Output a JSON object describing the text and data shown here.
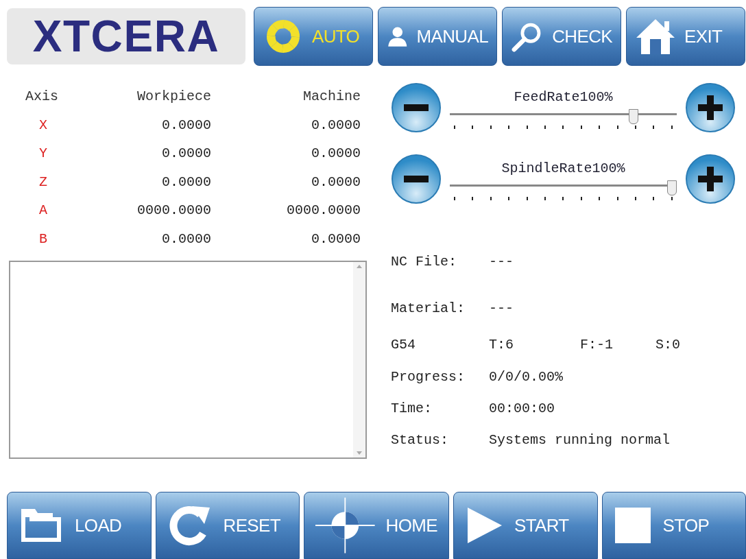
{
  "logo": "XTCERA",
  "mode_buttons": [
    {
      "kind": "auto",
      "label": "AUTO",
      "selected": true
    },
    {
      "kind": "manual",
      "label": "MANUAL",
      "selected": false
    },
    {
      "kind": "check",
      "label": "CHECK",
      "selected": false
    },
    {
      "kind": "exit",
      "label": "EXIT",
      "selected": false
    }
  ],
  "axis_table": {
    "columns": [
      "Axis",
      "Workpiece",
      "Machine"
    ],
    "rows": [
      {
        "axis": "X",
        "workpiece": "0.0000",
        "machine": "0.0000"
      },
      {
        "axis": "Y",
        "workpiece": "0.0000",
        "machine": "0.0000"
      },
      {
        "axis": "Z",
        "workpiece": "0.0000",
        "machine": "0.0000"
      },
      {
        "axis": "A",
        "workpiece": "0000.0000",
        "machine": "0000.0000"
      },
      {
        "axis": "B",
        "workpiece": "0.0000",
        "machine": "0.0000"
      }
    ]
  },
  "sliders": [
    {
      "label": "FeedRate100%",
      "level": 0.83
    },
    {
      "label": "SpindleRate100%",
      "level": 1
    }
  ],
  "info": {
    "nc_file": {
      "label": "NC File:",
      "value": "---"
    },
    "material": {
      "label": "Material:",
      "value": "---"
    },
    "codes": [
      "G54",
      "T:6",
      "F:-1",
      "S:0"
    ],
    "progress": {
      "label": "Progress:",
      "value": "0/0/0.00%"
    },
    "time": {
      "label": "Time:",
      "value": "00:00:00"
    },
    "status": {
      "label": "Status:",
      "value": "Systems running normal"
    }
  },
  "action_buttons": [
    {
      "kind": "load",
      "label": "LOAD"
    },
    {
      "kind": "reset",
      "label": "RESET"
    },
    {
      "kind": "home",
      "label": "HOME"
    },
    {
      "kind": "start",
      "label": "START"
    },
    {
      "kind": "stop",
      "label": "STOP"
    }
  ]
}
